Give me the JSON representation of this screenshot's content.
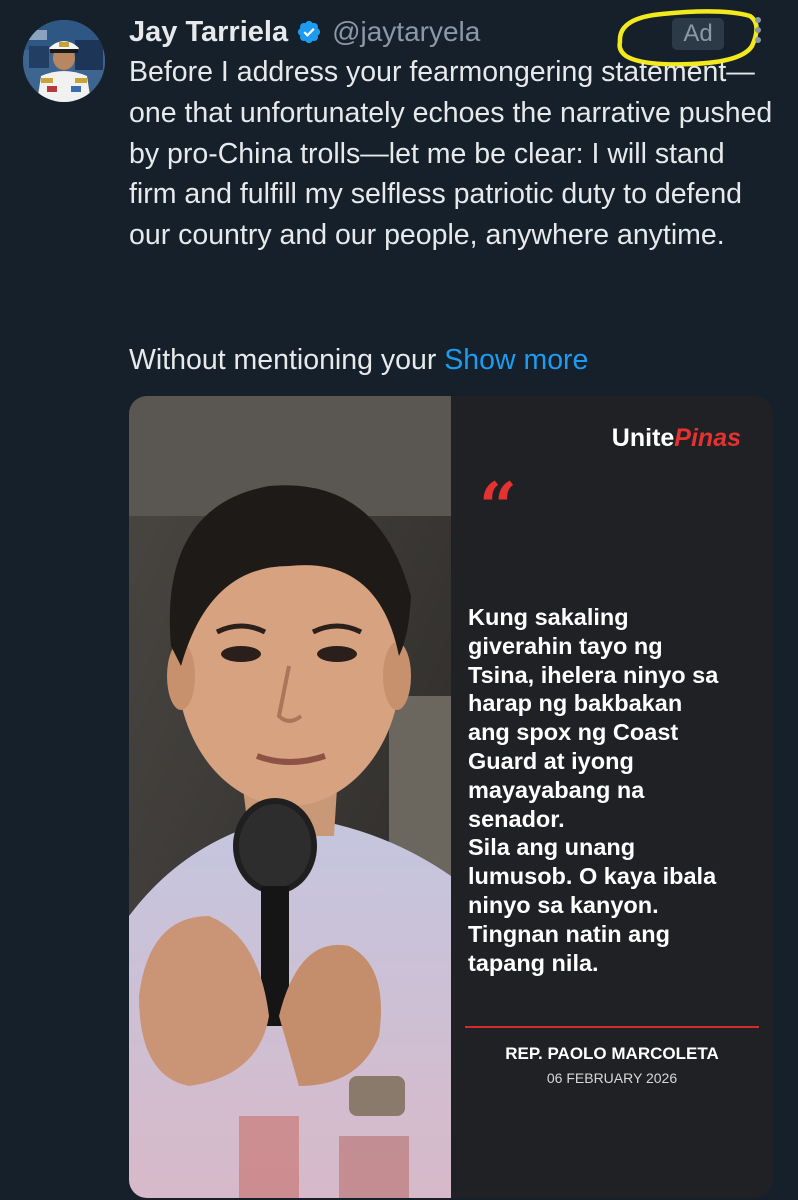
{
  "post": {
    "author": {
      "display_name": "Jay Tarriela",
      "handle": "@jaytaryela",
      "verified": true
    },
    "ad_label": "Ad",
    "text_part1": "Before I address your fearmongering statement—one that unfortunately echoes the narrative pushed by pro-China trolls—let me be clear: I will stand firm and fulfill my selfless patriotic duty to defend our country and our people, anywhere anytime.",
    "text_part2": "Without mentioning your ",
    "show_more_label": "Show more"
  },
  "media_card": {
    "brand_part1": "Unite",
    "brand_part2": "Pinas",
    "quote_mark": "“",
    "quote_text": "Kung sakaling\ngiverahin tayo ng\nTsina, ihelera ninyo sa\nharap ng bakbakan\nang spox ng Coast\nGuard at iyong\nmayayabang na\nsenador.\nSila ang unang\nlumusob. O kaya ibala\nninyo sa kanyon.\nTingnan natin ang\ntapang nila.",
    "speaker": "REP. PAOLO MARCOLETA",
    "date": "06 FEBRUARY 2026"
  },
  "icons": {
    "verified": "verified-badge-icon",
    "more": "more-options-icon"
  },
  "colors": {
    "background": "#15202b",
    "text": "#e7e9ea",
    "muted": "#8b98a5",
    "link": "#1d9bf0",
    "verified_blue": "#1d9bf0",
    "highlight_yellow": "#f2ea1c",
    "brand_red": "#e63131"
  }
}
